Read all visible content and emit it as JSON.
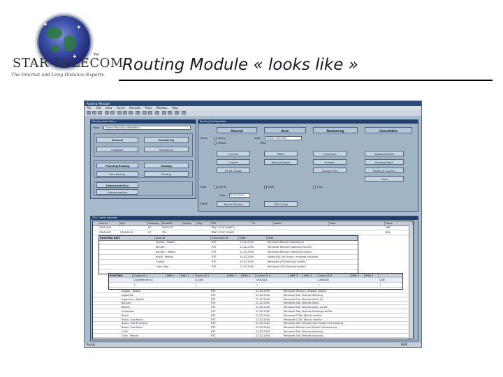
{
  "logo": {
    "brand": "STAR TELECOM",
    "tagline": "The Internet and Long Distance Experts",
    "tm": "TM"
  },
  "title": "Routing Module « looks like »",
  "app": {
    "window_title": "Routing Manager",
    "menu": [
      "File",
      "Edit",
      "View",
      "Forms",
      "Records",
      "Tools",
      "Window",
      "Help"
    ],
    "status": "Ready",
    "status_right": "NUM"
  },
  "left_window": {
    "title": "Routing Main Menu",
    "view_label": "View",
    "view_value": "General Routing Information",
    "buttons": {
      "general": "General",
      "numbering": "Numbering",
      "customer": "Customer",
      "numbering_sub": "Numbering",
      "planning": "Planning/Routing",
      "routing": "Routing",
      "new_routing": "New Routing",
      "routing_sub": "Routing",
      "interconnection": "Interconnection",
      "interconnection_sub": "Interconnection"
    }
  },
  "right_window": {
    "title": "Routing Configuration",
    "tabs": [
      "General",
      "Area",
      "Numbering",
      "Consolidate"
    ],
    "labels": {
      "show": "Show",
      "query": "Query",
      "report": "Report",
      "area": "Area",
      "area_value": "Telstar Company",
      "filter": "Filter",
      "note": "Note",
      "date": "Date",
      "date_value": "23/01/2001",
      "note_value": "Note",
      "mode": "Mode"
    },
    "radios": [
      "Query",
      "Report"
    ],
    "checks": [
      "Carrier",
      "Note",
      "Flag"
    ],
    "buttons": {
      "carriers": "Carriers",
      "rates": "Rates",
      "customers": "Customers",
      "updated_routes": "Updated Routes",
      "choices": "Choices",
      "routing_report": "Routing Report",
      "prefixes": "Prefixes",
      "routing_detail": "Routing Detail",
      "route_groups": "Route Groups",
      "route_by_country": "Route by Country",
      "report_routing": "Report Routing",
      "dms_script": "DMS Script",
      "country_routing": "Country Routing",
      "close": "Close",
      "components": "Components",
      "dest_routing": "Dest. Routing"
    }
  },
  "main_grid": {
    "title": "RTG Carrier Services",
    "columns": [
      "",
      "Carrier",
      "Sigf",
      "Category",
      "RouteID",
      "Sigflag",
      "Qlty",
      "TRK",
      "D",
      "Name",
      "Rate",
      "Mode"
    ],
    "rows": [
      [
        "",
        "STAR.OVA",
        "",
        "EP",
        "NORS-OT",
        "",
        "",
        "TRNT (CUST WEST)",
        "",
        "",
        "",
        "NRT"
      ],
      [
        "",
        "STAR.HOT",
        "STAR.PLUS",
        "CT",
        "TRL",
        "",
        "",
        "TRNT (CUST SANT)",
        "",
        "",
        "",
        "BRL"
      ]
    ]
  },
  "hist_grid": {
    "columns": [
      "ROUTING HIST",
      "Area ID",
      "Command ID",
      "Date",
      "Note"
    ],
    "rows": [
      [
        "",
        "Algeria - Mobile",
        "RTE",
        "11.02.2000",
        "Removed Telecom Algeria-full"
      ],
      [
        "",
        "Bahrain",
        "RTE",
        "11.02.2000",
        "Removed Telecom (Bahrain) conflict"
      ],
      [
        "",
        "Bahrain - Mobile",
        "RTE",
        "11.02.2000",
        "Removed Telecom (Bahrain) conflict"
      ],
      [
        "",
        "Brazil - Mobile",
        "RTE",
        "15.02.2000",
        "Added BGL for choice, removed and bore"
      ],
      [
        "",
        "Croatia",
        "RTE",
        "05.02.2000",
        "Removed VTN blocking conflict"
      ],
      [
        "",
        "Czech Rep.",
        "RTE",
        "11.02.2000",
        "Removed VTN blocking conflict"
      ]
    ]
  },
  "choice_grid": {
    "columns": [
      "ROUTING",
      "Choice ID 1",
      "NRR 1",
      "RND 1",
      "Choice ID 2",
      "NRR 2",
      "RND 2",
      "Choice ID 3",
      "NRR 3",
      "RND 3",
      "Choice ID 4",
      "NRR 4",
      "RND 4"
    ],
    "rows": [
      [
        "",
        "CAN/Telecom (S",
        "",
        "",
        "CC-VAT",
        "",
        "",
        "US/CGDL",
        "",
        "",
        "CAN/Cals",
        "",
        "CAN"
      ],
      [
        "",
        "1",
        "",
        "",
        "1",
        "",
        "",
        "1",
        "",
        "",
        "1",
        "",
        "1"
      ]
    ]
  },
  "lower_rows": [
    [
      "Angola - Mobile",
      "RTE",
      "22.02.2000",
      "Removed Telecom (Angola) conflict"
    ],
    [
      "Argentina",
      "RTE",
      "22.02.2000",
      "Removed Star Telecom blocking"
    ],
    [
      "Argentina - Mobile",
      "RTE",
      "22.02.2000",
      "Removed Star Telecom block (S)"
    ],
    [
      "Bahrain",
      "RTE",
      "22.02.2000",
      "Removed Star Telecom block"
    ],
    [
      "Bolivia",
      "RTE",
      "22.02.2000",
      "Removed Star Telecom block (route)"
    ],
    [
      "Cameroon",
      "RTE",
      "22.02.2000",
      "Removed Star Telecom blocking conflict"
    ],
    [
      "Brazil",
      "RTE",
      "22.02.2000",
      "Removed CGDL (Brazil) conflict"
    ],
    [
      "Brazil - Sao Paulo",
      "RTE",
      "22.02.2000",
      "Removed CGDL (Brazil) conflict"
    ],
    [
      "Brazil - Rio de Janeiro",
      "RTE",
      "22.02.2000",
      "Removed Star Telecom with Global One blocking"
    ],
    [
      "Brazil - Sao Paulo",
      "RTE",
      "22.02.2000",
      "Removed Telecom and Global One blocking"
    ],
    [
      "Chile",
      "RTE",
      "22.02.2000",
      "Removed Star Telecom blocking"
    ],
    [
      "Chile - Mobile",
      "RTE",
      "22.02.2000",
      "Removed Star Telecom blocking"
    ]
  ]
}
